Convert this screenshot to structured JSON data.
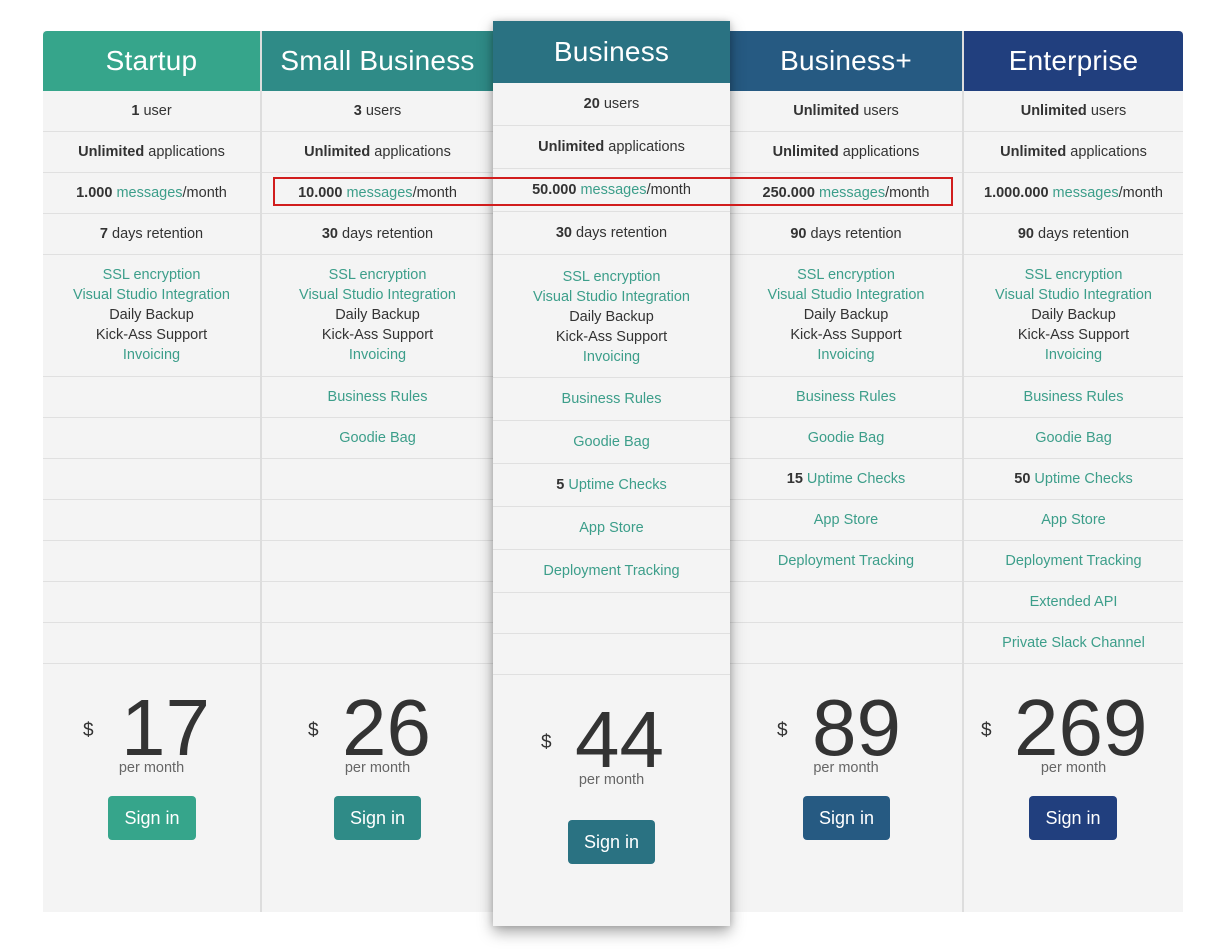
{
  "plans": [
    {
      "name": "Startup",
      "color": "#36a58b",
      "users": {
        "value": "1",
        "label": "user"
      },
      "applications": {
        "value": "Unlimited",
        "label": "applications"
      },
      "messages": {
        "value": "1.000",
        "link": "messages",
        "suffix": "/month"
      },
      "retention": {
        "value": "7",
        "label": "days retention"
      },
      "features": [
        {
          "text": "SSL encryption",
          "link": true
        },
        {
          "text": "Visual Studio Integration",
          "link": true
        },
        {
          "text": "Daily Backup",
          "link": false
        },
        {
          "text": "Kick-Ass Support",
          "link": false
        },
        {
          "text": "Invoicing",
          "link": true
        }
      ],
      "extras": [],
      "currency": "$",
      "price": "17",
      "period": "per month",
      "button": "Sign in"
    },
    {
      "name": "Small Business",
      "color": "#2f8b87",
      "users": {
        "value": "3",
        "label": "users"
      },
      "applications": {
        "value": "Unlimited",
        "label": "applications"
      },
      "messages": {
        "value": "10.000",
        "link": "messages",
        "suffix": "/month"
      },
      "retention": {
        "value": "30",
        "label": "days retention"
      },
      "features": [
        {
          "text": "SSL encryption",
          "link": true
        },
        {
          "text": "Visual Studio Integration",
          "link": true
        },
        {
          "text": "Daily Backup",
          "link": false
        },
        {
          "text": "Kick-Ass Support",
          "link": false
        },
        {
          "text": "Invoicing",
          "link": true
        }
      ],
      "extras": [
        {
          "text": "Business Rules"
        },
        {
          "text": "Goodie Bag"
        }
      ],
      "currency": "$",
      "price": "26",
      "period": "per month",
      "button": "Sign in"
    },
    {
      "name": "Business",
      "color": "#2a7282",
      "users": {
        "value": "20",
        "label": "users"
      },
      "applications": {
        "value": "Unlimited",
        "label": "applications"
      },
      "messages": {
        "value": "50.000",
        "link": "messages",
        "suffix": "/month"
      },
      "retention": {
        "value": "30",
        "label": "days retention"
      },
      "features": [
        {
          "text": "SSL encryption",
          "link": true
        },
        {
          "text": "Visual Studio Integration",
          "link": true
        },
        {
          "text": "Daily Backup",
          "link": false
        },
        {
          "text": "Kick-Ass Support",
          "link": false
        },
        {
          "text": "Invoicing",
          "link": true
        }
      ],
      "extras": [
        {
          "text": "Business Rules"
        },
        {
          "text": "Goodie Bag"
        },
        {
          "bold": "5",
          "text": "Uptime Checks"
        },
        {
          "text": "App Store"
        },
        {
          "text": "Deployment Tracking"
        }
      ],
      "currency": "$",
      "price": "44",
      "period": "per month",
      "button": "Sign in"
    },
    {
      "name": "Business+",
      "color": "#265a82",
      "users": {
        "value": "Unlimited",
        "label": "users"
      },
      "applications": {
        "value": "Unlimited",
        "label": "applications"
      },
      "messages": {
        "value": "250.000",
        "link": "messages",
        "suffix": "/month"
      },
      "retention": {
        "value": "90",
        "label": "days retention"
      },
      "features": [
        {
          "text": "SSL encryption",
          "link": true
        },
        {
          "text": "Visual Studio Integration",
          "link": true
        },
        {
          "text": "Daily Backup",
          "link": false
        },
        {
          "text": "Kick-Ass Support",
          "link": false
        },
        {
          "text": "Invoicing",
          "link": true
        }
      ],
      "extras": [
        {
          "text": "Business Rules"
        },
        {
          "text": "Goodie Bag"
        },
        {
          "bold": "15",
          "text": "Uptime Checks"
        },
        {
          "text": "App Store"
        },
        {
          "text": "Deployment Tracking"
        }
      ],
      "currency": "$",
      "price": "89",
      "period": "per month",
      "button": "Sign in"
    },
    {
      "name": "Enterprise",
      "color": "#213f7e",
      "users": {
        "value": "Unlimited",
        "label": "users"
      },
      "applications": {
        "value": "Unlimited",
        "label": "applications"
      },
      "messages": {
        "value": "1.000.000",
        "link": "messages",
        "suffix": "/month"
      },
      "retention": {
        "value": "90",
        "label": "days retention"
      },
      "features": [
        {
          "text": "SSL encryption",
          "link": true
        },
        {
          "text": "Visual Studio Integration",
          "link": true
        },
        {
          "text": "Daily Backup",
          "link": false
        },
        {
          "text": "Kick-Ass Support",
          "link": false
        },
        {
          "text": "Invoicing",
          "link": true
        }
      ],
      "extras": [
        {
          "text": "Business Rules"
        },
        {
          "text": "Goodie Bag"
        },
        {
          "bold": "50",
          "text": "Uptime Checks"
        },
        {
          "text": "App Store"
        },
        {
          "text": "Deployment Tracking"
        },
        {
          "text": "Extended API"
        },
        {
          "text": "Private Slack Channel"
        }
      ],
      "currency": "$",
      "price": "269",
      "period": "per month",
      "button": "Sign in"
    }
  ],
  "link_color": "#3c9e8a",
  "highlight_color": "#d11d1d"
}
